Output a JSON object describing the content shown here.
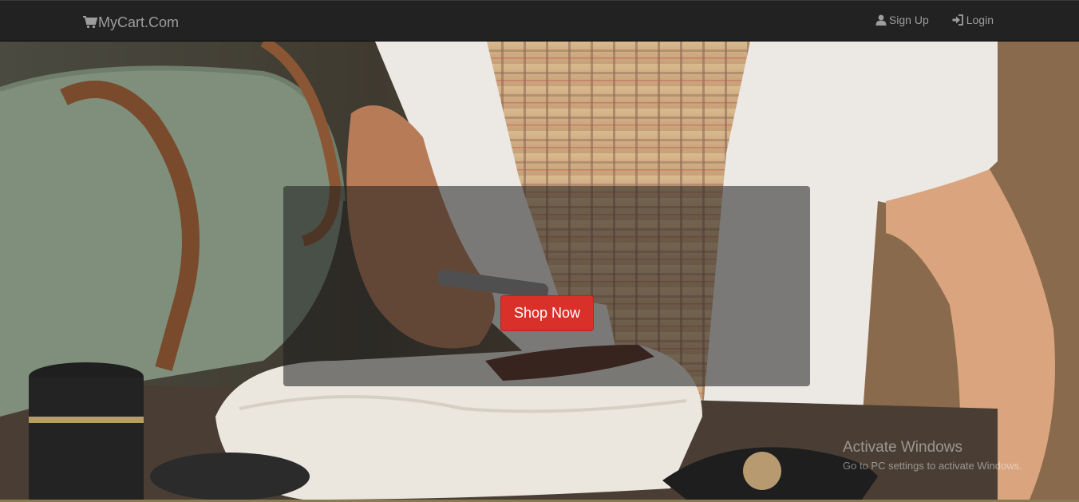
{
  "navbar": {
    "brand": "MyCart.Com",
    "brand_icon": "shopping-cart-icon",
    "links": [
      {
        "label": "Sign Up",
        "icon": "user-icon"
      },
      {
        "label": "Login",
        "icon": "log-in-icon"
      }
    ]
  },
  "hero": {
    "cta_label": "Shop Now",
    "cta_color": "#d9302a"
  },
  "watermark": {
    "title": "Activate Windows",
    "subtitle": "Go to PC settings to activate Windows."
  },
  "colors": {
    "navbar_bg": "#222222",
    "nav_text": "#9d9d9d"
  }
}
